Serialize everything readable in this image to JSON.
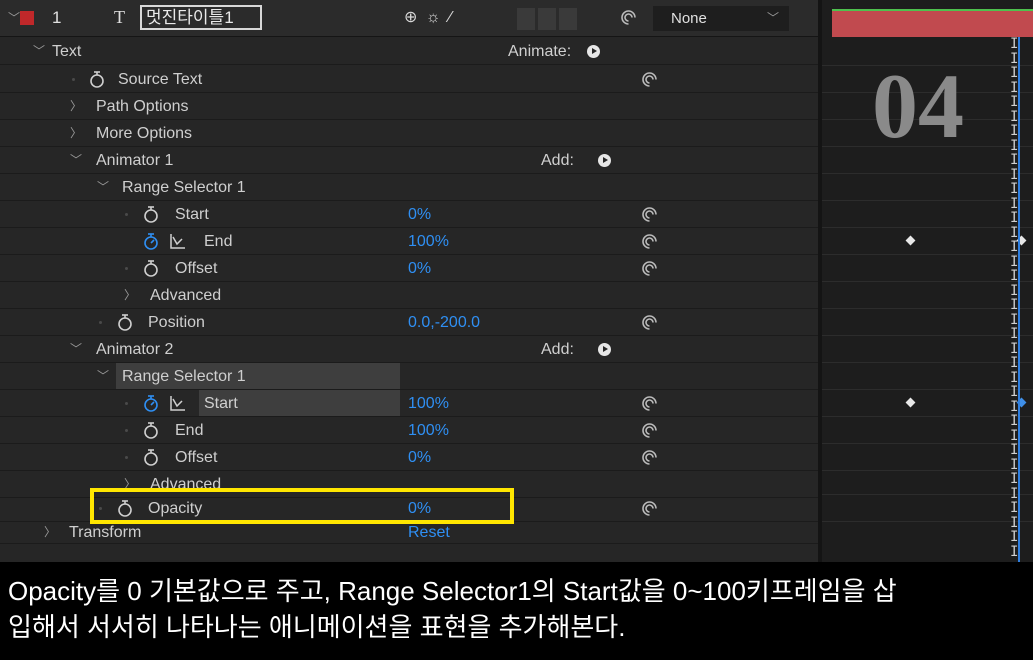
{
  "layer": {
    "index": "1",
    "type_glyph": "T",
    "name": "멋진타이틀1",
    "switch_icons": "⊕ ☼ ⁄",
    "parent_value": "None",
    "color": "#c0282a"
  },
  "rows": {
    "text_group": "Text",
    "animate_label": "Animate:",
    "source_text": "Source Text",
    "path_options": "Path Options",
    "more_options": "More Options",
    "animator1": "Animator 1",
    "add1": "Add:",
    "range_selector1": "Range Selector 1",
    "start1": "Start",
    "start1_val": "0",
    "start1_unit": "%",
    "end1": "End",
    "end1_val": "100",
    "end1_unit": "%",
    "offset1": "Offset",
    "offset1_val": "0",
    "offset1_unit": "%",
    "advanced1": "Advanced",
    "position": "Position",
    "position_val": "0.0,-200.0",
    "animator2": "Animator 2",
    "add2": "Add:",
    "range_selector2": "Range Selector 1",
    "start2": "Start",
    "start2_val": "100",
    "start2_unit": "%",
    "end2": "End",
    "end2_val": "100",
    "end2_unit": "%",
    "offset2": "Offset",
    "offset2_val": "0",
    "offset2_unit": "%",
    "advanced2": "Advanced",
    "opacity": "Opacity",
    "opacity_val": "0",
    "opacity_unit": "%",
    "transform": "Transform",
    "reset": "Reset"
  },
  "timeline": {
    "frame_number": "04",
    "bar_color": "#c14a4f"
  },
  "colors": {
    "accent_blue": "#2f8ff3",
    "highlight_box": "#ffe600"
  },
  "caption": {
    "line1": "Opacity를 0 기본값으로 주고, Range Selector1의 Start값을 0~100키프레임을 삽",
    "line2": "입해서 서서히 나타나는 애니메이션을 표현을 추가해본다."
  }
}
